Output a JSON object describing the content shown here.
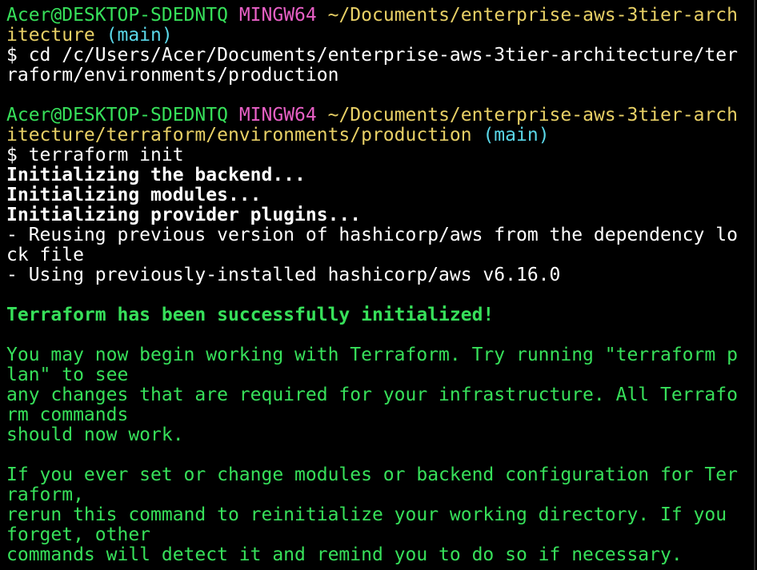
{
  "terminal": {
    "colors": {
      "background": "#000000",
      "user_host": "#37e05a",
      "mingw": "#e860c6",
      "path": "#e8d066",
      "branch": "#5ad7e8",
      "text": "#ffffff",
      "success": "#37e05a"
    },
    "prompt1": {
      "user_host": "Acer@DESKTOP-SDEDNTQ",
      "system": "MINGW64",
      "path_part1": "~/Documents/enterprise-aws-3tier-arch",
      "path_part2": "itecture",
      "branch": "(main)"
    },
    "command1": {
      "line1": "$ cd /c/Users/Acer/Documents/enterprise-aws-3tier-architecture/ter",
      "line2": "raform/environments/production"
    },
    "prompt2": {
      "user_host": "Acer@DESKTOP-SDEDNTQ",
      "system": "MINGW64",
      "path_part1": "~/Documents/enterprise-aws-3tier-arch",
      "path_part2": "itecture/terraform/environments/production",
      "branch": "(main)"
    },
    "command2": "$ terraform init",
    "output": {
      "init_backend": "Initializing the backend...",
      "init_modules": "Initializing modules...",
      "init_plugins": "Initializing provider plugins...",
      "reuse_line1": "- Reusing previous version of hashicorp/aws from the dependency lo",
      "reuse_line2": "ck file",
      "using_line": "- Using previously-installed hashicorp/aws v6.16.0",
      "success": "Terraform has been successfully initialized!",
      "msg1_l1": "You may now begin working with Terraform. Try running \"terraform p",
      "msg1_l2": "lan\" to see",
      "msg1_l3": "any changes that are required for your infrastructure. All Terrafo",
      "msg1_l4": "rm commands",
      "msg1_l5": "should now work.",
      "msg2_l1": "If you ever set or change modules or backend configuration for Ter",
      "msg2_l2": "raform,",
      "msg2_l3": "rerun this command to reinitialize your working directory. If you",
      "msg2_l4": "forget, other",
      "msg2_l5": "commands will detect it and remind you to do so if necessary."
    }
  }
}
